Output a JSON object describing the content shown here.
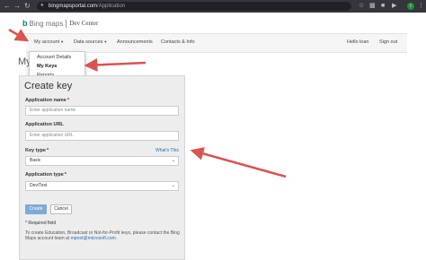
{
  "browser": {
    "url_host": "bingmapsportal.com",
    "url_path": "/Application",
    "back_icon": "arrow-left-icon",
    "profile_initial": "I"
  },
  "header": {
    "logo_bing": "Bing",
    "logo_maps": "maps",
    "logo_dev_center": "Dev Center"
  },
  "nav": {
    "my_account": "My account",
    "data_sources": "Data sources",
    "announcements": "Announcements",
    "contacts_info": "Contacts & Info",
    "hello_user": "Hello loan",
    "sign_out": "Sign out"
  },
  "dropdown": {
    "items": [
      "Account Details",
      "My Keys",
      "Reports"
    ]
  },
  "page": {
    "heading_partial": "My"
  },
  "form": {
    "title": "Create key",
    "app_name_label": "Application name",
    "app_name_placeholder": "Enter application name",
    "app_url_label": "Application URL",
    "app_url_placeholder": "Enter application URL",
    "key_type_label": "Key type",
    "whats_this": "What's This",
    "key_type_value": "Basic",
    "app_type_label": "Application type",
    "app_type_value": "Dev/Test",
    "create_label": "Create",
    "cancel_label": "Cancel",
    "required_note": "Required field",
    "required_star": "*",
    "help_text": "To create Education, Broadcast or Not-for-Profit keys, please contact the Bing Maps account team at",
    "help_email": "mpnet@microsoft.com",
    "help_suffix": "."
  },
  "annotations": {
    "arrow_color": "#d9534f"
  }
}
